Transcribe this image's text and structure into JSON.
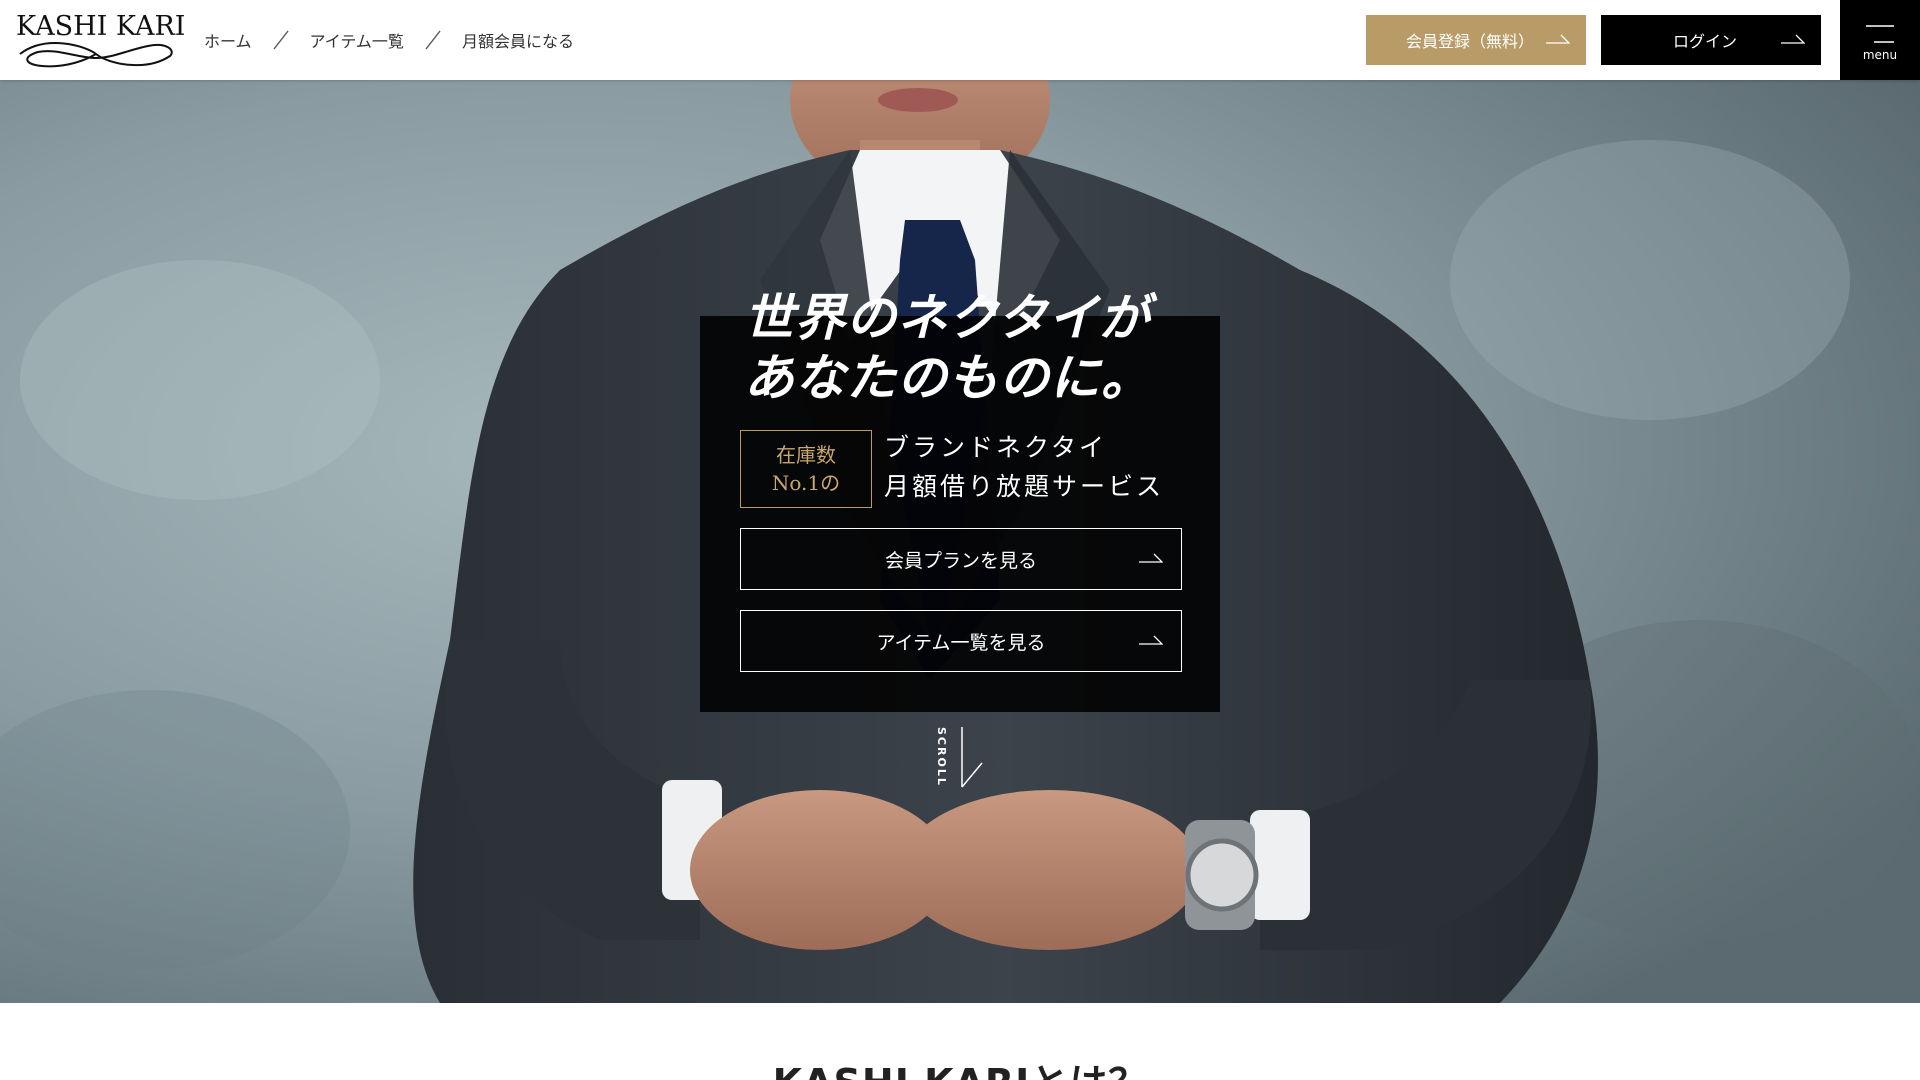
{
  "brand": {
    "logo_text": "KASHI KARI"
  },
  "breadcrumb": {
    "items": [
      "ホーム",
      "アイテム一覧",
      "月額会員になる"
    ]
  },
  "header": {
    "register_label": "会員登録（無料）",
    "login_label": "ログイン",
    "menu_label": "menu"
  },
  "hero": {
    "catch_line1": "世界のネクタイが",
    "catch_line2": "あなたのものに。",
    "badge_line1": "在庫数",
    "badge_line2": "No.1の",
    "service_line1": "ブランドネクタイ",
    "service_line2": "月額借り放題サービス",
    "plan_button": "会員プランを見る",
    "items_button": "アイテム一覧を見る",
    "scroll_label": "SCROLL"
  },
  "about": {
    "title": "KASHI KARIとは？"
  },
  "colors": {
    "accent_gold": "#b89b66",
    "black": "#000000",
    "white": "#ffffff"
  },
  "icons": [
    "arrow-right-icon",
    "menu-icon",
    "scroll-arrow-icon",
    "slash-separator-icon"
  ]
}
